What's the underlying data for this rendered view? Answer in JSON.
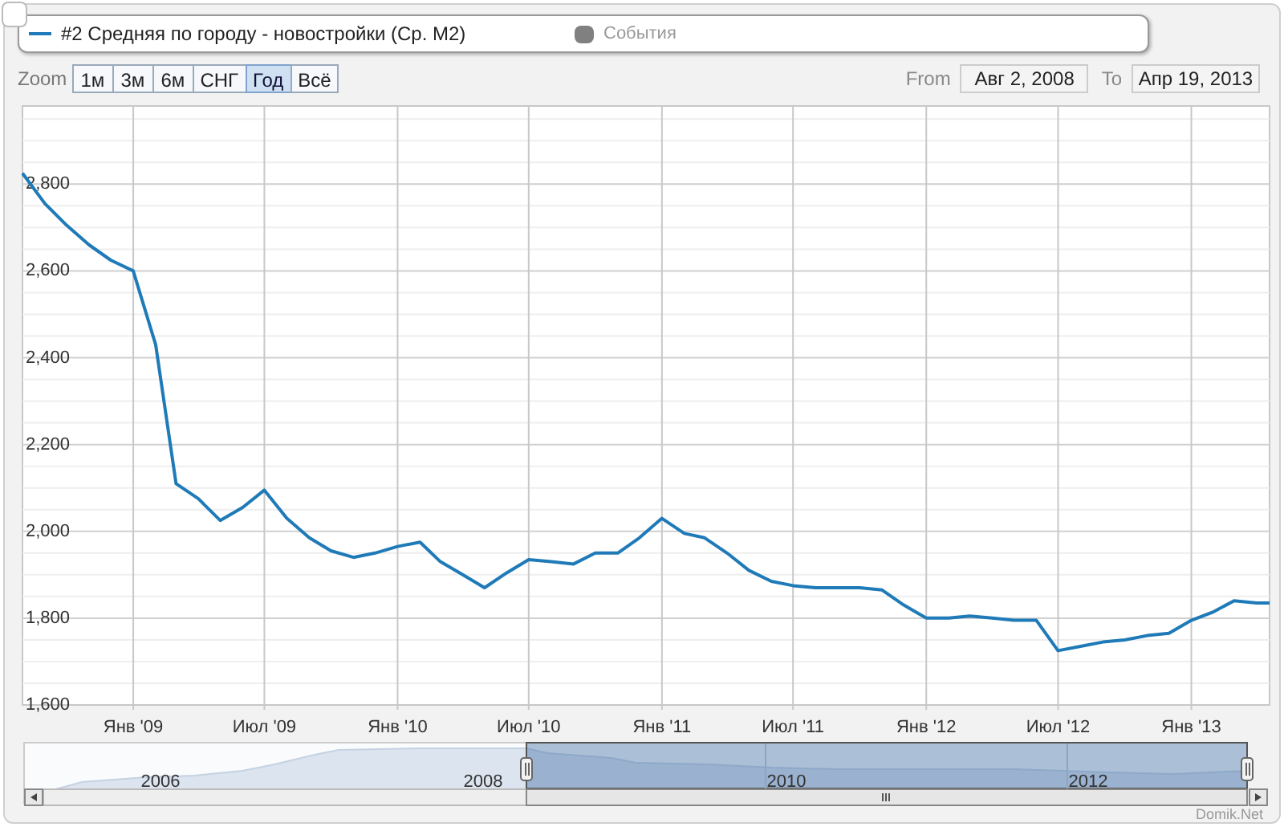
{
  "legend": [
    {
      "kind": "series",
      "visible": true
    },
    {
      "kind": "events",
      "label": "События",
      "visible": false,
      "color": "#808080"
    }
  ],
  "zoom": {
    "label": "Zoom",
    "buttons": [
      {
        "label": "1м",
        "selected": false
      },
      {
        "label": "3м",
        "selected": false
      },
      {
        "label": "6м",
        "selected": false
      },
      {
        "label": "СНГ",
        "selected": false
      },
      {
        "label": "Год",
        "selected": true
      },
      {
        "label": "Всё",
        "selected": false
      }
    ]
  },
  "range": {
    "from_label": "From",
    "from": "Авг 2, 2008",
    "to_label": "To",
    "to": "Апр 19, 2013"
  },
  "chart": {
    "chart_data": {
      "type": "line",
      "grid": true,
      "xlim": [
        "2008-08-01",
        "2013-04-19"
      ],
      "ylim": [
        1600,
        2980
      ],
      "x": [
        "2008-08",
        "2008-09",
        "2008-10",
        "2008-11",
        "2008-12",
        "2009-01",
        "2009-02",
        "2009-03",
        "2009-04",
        "2009-05",
        "2009-06",
        "2009-07",
        "2009-08",
        "2009-09",
        "2009-10",
        "2009-11",
        "2009-12",
        "2010-01",
        "2010-02",
        "2010-03",
        "2010-04",
        "2010-05",
        "2010-06",
        "2010-07",
        "2010-08",
        "2010-09",
        "2010-10",
        "2010-11",
        "2010-12",
        "2011-01",
        "2011-02",
        "2011-03",
        "2011-04",
        "2011-05",
        "2011-06",
        "2011-07",
        "2011-08",
        "2011-09",
        "2011-10",
        "2011-11",
        "2011-12",
        "2012-01",
        "2012-02",
        "2012-03",
        "2012-04",
        "2012-05",
        "2012-06",
        "2012-07",
        "2012-08",
        "2012-09",
        "2012-10",
        "2012-11",
        "2012-12",
        "2013-01",
        "2013-02",
        "2013-03",
        "2013-04",
        "2013-04-19"
      ],
      "series": [
        {
          "name": "#2 Средняя по городу - новостройки (Ср. М2)",
          "color": "#1f7ab8",
          "values": [
            2825,
            2755,
            2705,
            2660,
            2625,
            2600,
            2430,
            2110,
            2075,
            2025,
            2055,
            2095,
            2030,
            1985,
            1955,
            1940,
            1950,
            1965,
            1975,
            1930,
            1900,
            1870,
            1905,
            1935,
            1930,
            1925,
            1950,
            1950,
            1985,
            2030,
            1995,
            1985,
            1950,
            1910,
            1885,
            1875,
            1870,
            1870,
            1870,
            1865,
            1830,
            1800,
            1800,
            1805,
            1800,
            1795,
            1795,
            1725,
            1735,
            1745,
            1750,
            1760,
            1765,
            1795,
            1815,
            1840,
            1835,
            1835
          ]
        }
      ],
      "xticks": [
        {
          "value": "2009-01",
          "label": "Янв '09"
        },
        {
          "value": "2009-07",
          "label": "Июл '09"
        },
        {
          "value": "2010-01",
          "label": "Янв '10"
        },
        {
          "value": "2010-07",
          "label": "Июл '10"
        },
        {
          "value": "2011-01",
          "label": "Янв '11"
        },
        {
          "value": "2011-07",
          "label": "Июл '11"
        },
        {
          "value": "2012-01",
          "label": "Янв '12"
        },
        {
          "value": "2012-07",
          "label": "Июл '12"
        },
        {
          "value": "2013-01",
          "label": "Янв '13"
        }
      ],
      "yticks": [
        {
          "value": 1600,
          "label": "1,600"
        },
        {
          "value": 1800,
          "label": "1,800"
        },
        {
          "value": 2000,
          "label": "2,000"
        },
        {
          "value": 2200,
          "label": "2,200"
        },
        {
          "value": 2400,
          "label": "2,400"
        },
        {
          "value": 2600,
          "label": "2,600"
        },
        {
          "value": 2800,
          "label": "2,800"
        }
      ]
    }
  },
  "navigator": {
    "years": [
      "2006",
      "2008",
      "2010",
      "2012"
    ]
  },
  "credit": "Domik.Net"
}
